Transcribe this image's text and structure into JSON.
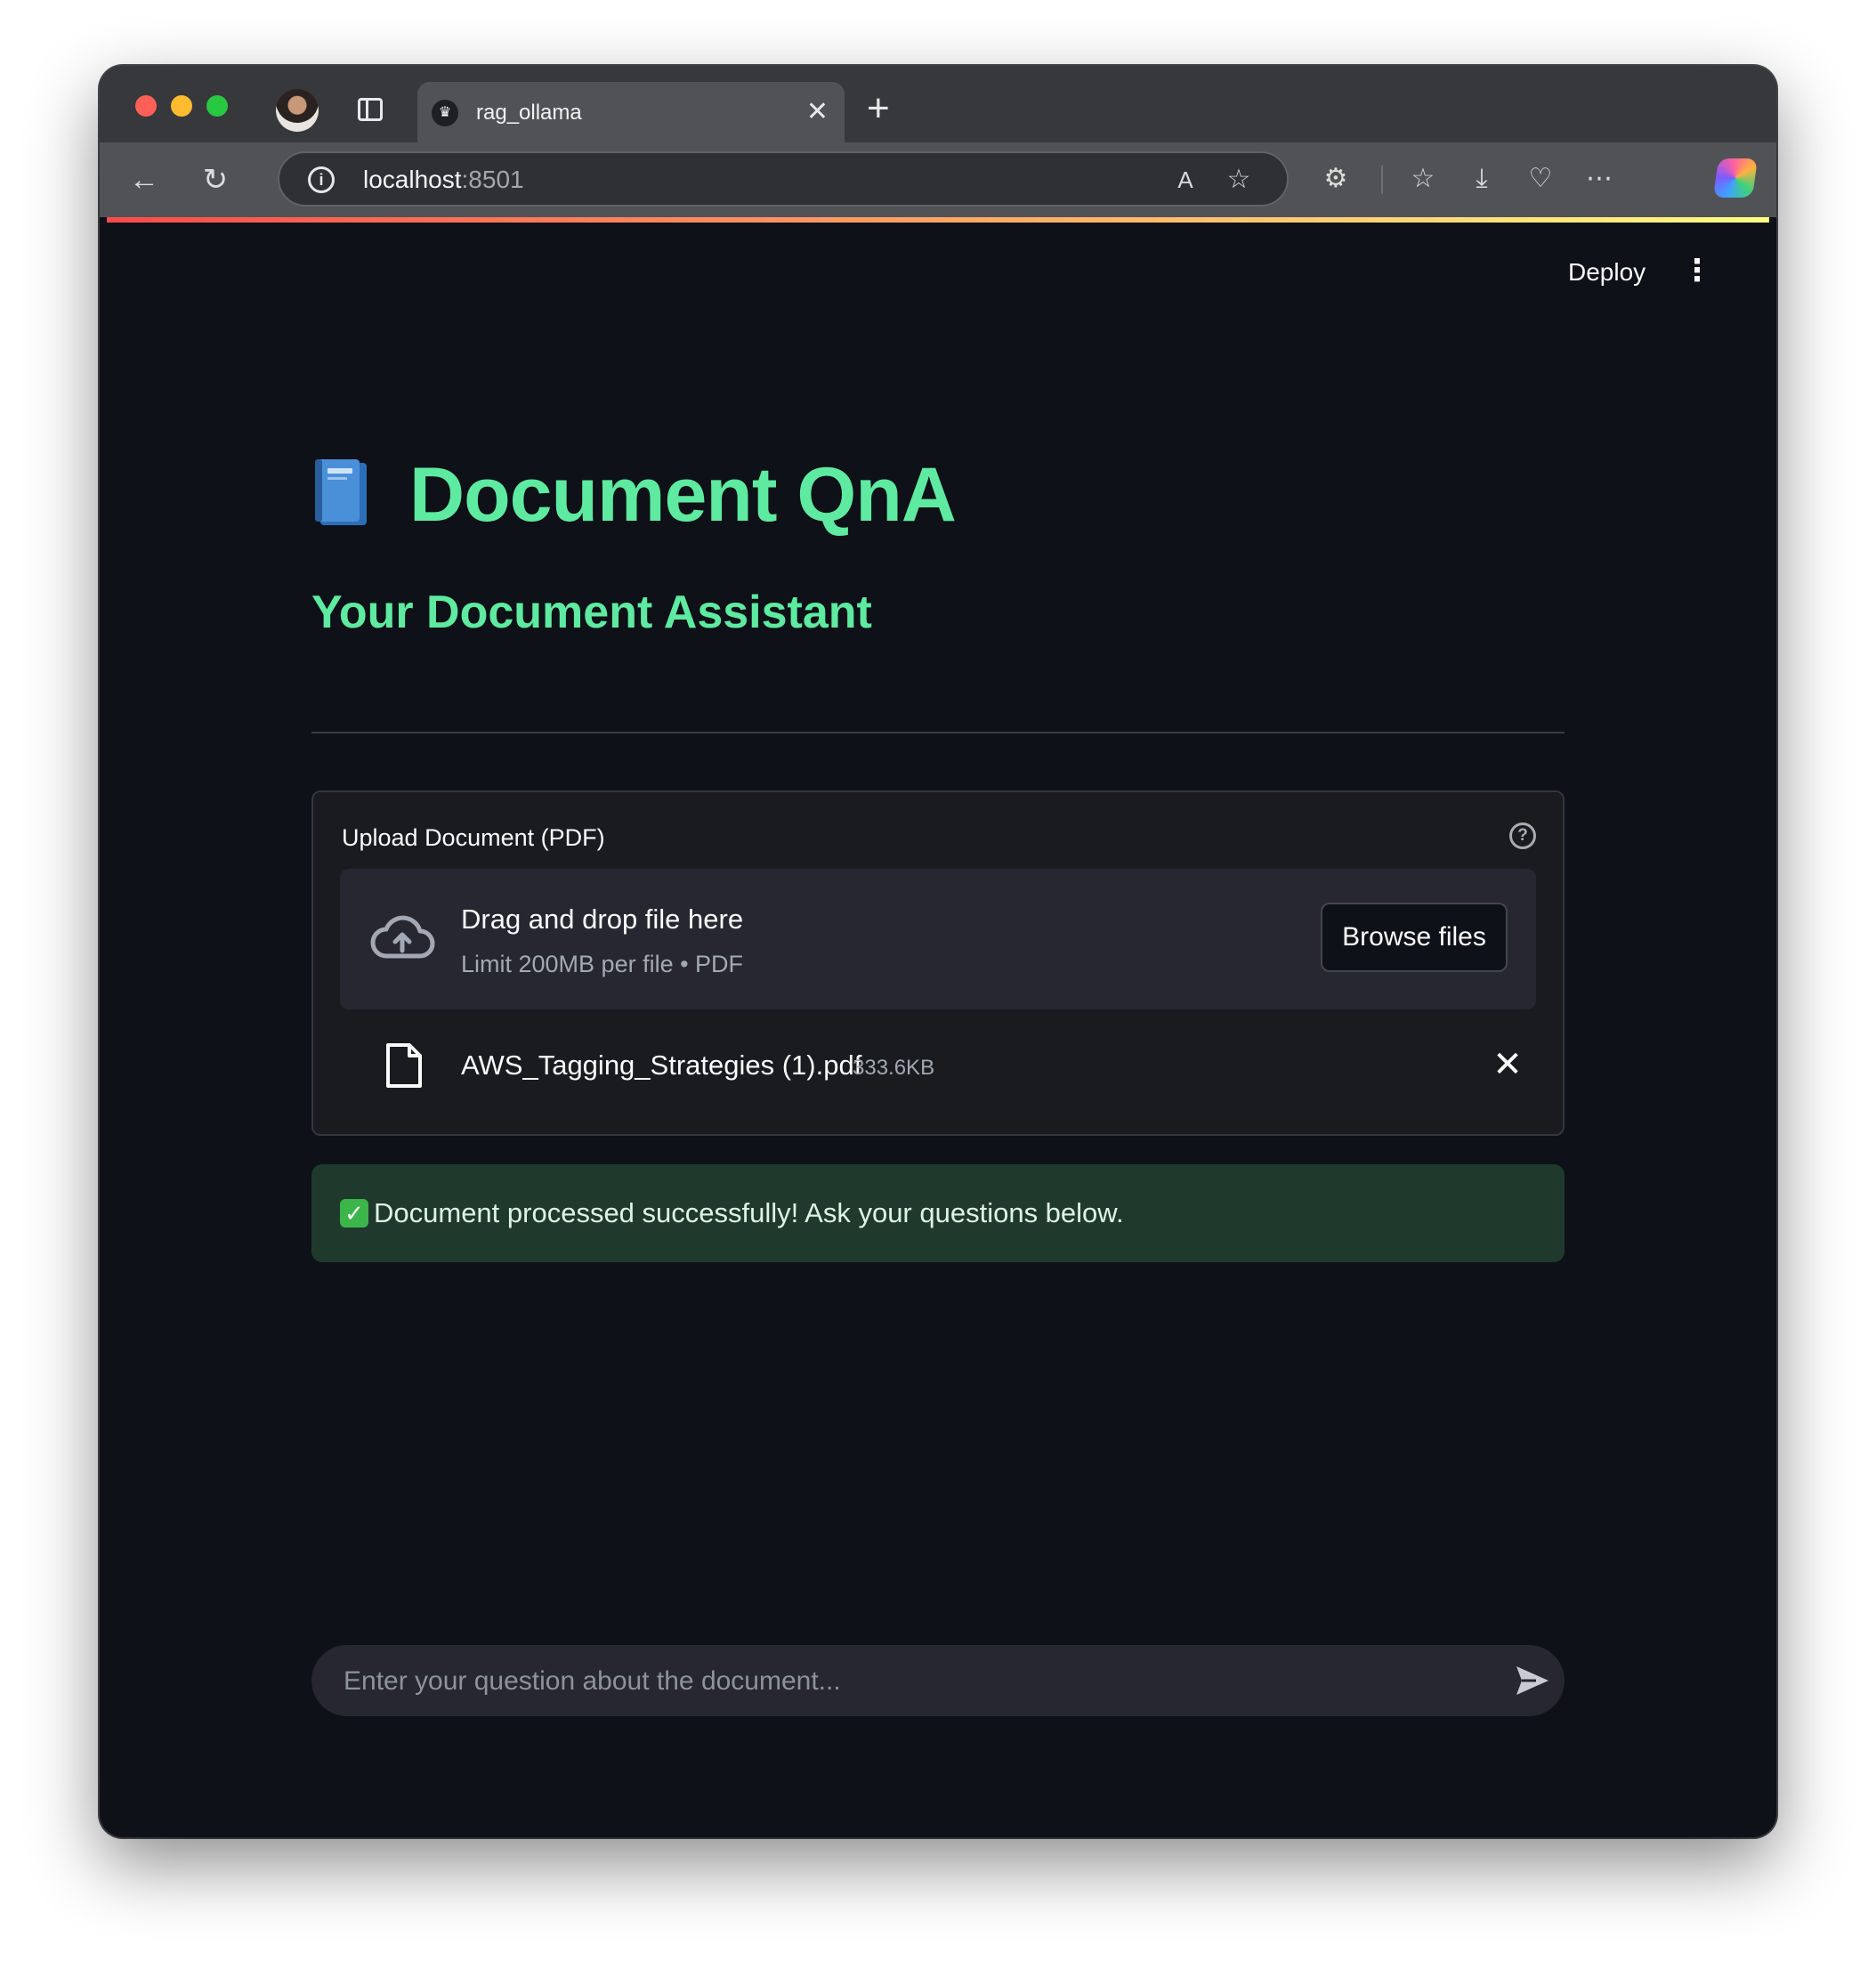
{
  "browser": {
    "tab_title": "rag_ollama",
    "url_host": "localhost",
    "url_port": ":8501"
  },
  "header": {
    "deploy_label": "Deploy",
    "menu_icon": "kebab-menu-icon"
  },
  "main": {
    "title": "Document QnA",
    "title_icon": "blue-book-icon",
    "subtitle": "Your Document Assistant"
  },
  "uploader": {
    "label": "Upload Document (PDF)",
    "drop_title": "Drag and drop file here",
    "drop_limit": "Limit 200MB per file • PDF",
    "browse_label": "Browse files",
    "file": {
      "name": "AWS_Tagging_Strategies (1).pdf",
      "size": "333.6KB"
    }
  },
  "status": {
    "message": "Document processed successfully! Ask your questions below."
  },
  "chat": {
    "placeholder": "Enter your question about the document..."
  },
  "colors": {
    "accent_green": "#5eeaa0",
    "page_bg": "#0e1117",
    "success_bg": "#1f3a2c"
  }
}
